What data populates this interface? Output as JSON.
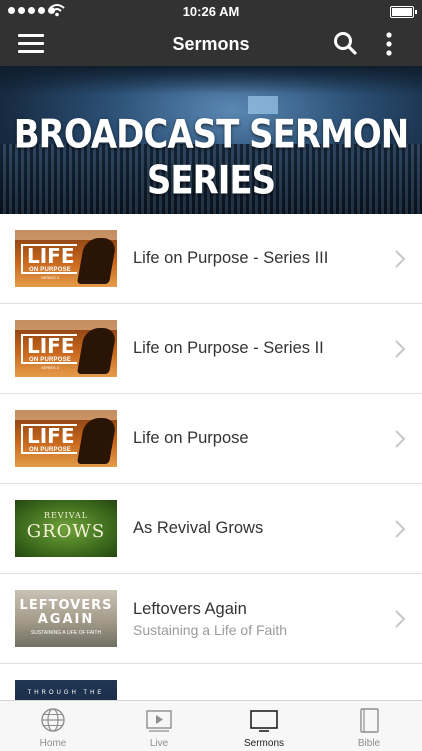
{
  "status_bar": {
    "time": "10:26 AM"
  },
  "nav_bar": {
    "title": "Sermons"
  },
  "hero": {
    "title": "BROADCAST SERMON SERIES"
  },
  "series": [
    {
      "title": "Life on Purpose - Series III",
      "subtitle": "",
      "thumb": {
        "word": "LIFE",
        "sub": "ON PURPOSE",
        "tag": "SERIES 3"
      }
    },
    {
      "title": "Life on Purpose - Series II",
      "subtitle": "",
      "thumb": {
        "word": "LIFE",
        "sub": "ON PURPOSE",
        "tag": "SERIES 2"
      }
    },
    {
      "title": "Life on Purpose",
      "subtitle": "",
      "thumb": {
        "word": "LIFE",
        "sub": "ON PURPOSE",
        "tag": ""
      }
    },
    {
      "title": "As Revival Grows",
      "subtitle": "",
      "thumb": {
        "small": "REVIVAL",
        "big": "GROWS"
      }
    },
    {
      "title": "Leftovers Again",
      "subtitle": "Sustaining a Life of Faith",
      "thumb": {
        "l1": "LEFTOVERS",
        "l2": "AGAIN",
        "l3": "SUSTAINING A LIFE OF FAITH"
      }
    },
    {
      "title": "",
      "subtitle": "",
      "thumb": {
        "t": "THROUGH THE"
      }
    }
  ],
  "tab_bar": {
    "tabs": [
      {
        "label": "Home",
        "icon": "globe-icon"
      },
      {
        "label": "Live",
        "icon": "play-icon"
      },
      {
        "label": "Sermons",
        "icon": "tv-icon",
        "active": true
      },
      {
        "label": "Bible",
        "icon": "book-icon"
      }
    ]
  },
  "colors": {
    "bar_background": "#323232",
    "tab_active": "#222222",
    "tab_inactive": "#8e8e8e"
  }
}
